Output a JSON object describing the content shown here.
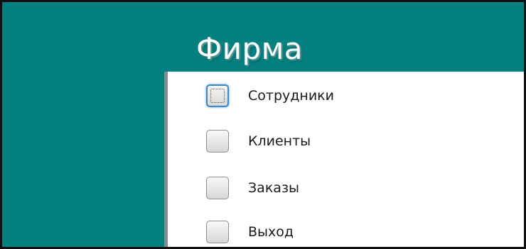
{
  "window": {
    "title": "Фирма",
    "background_color": "#058080"
  },
  "menu": {
    "items": [
      {
        "label": "Сотрудники",
        "checked": false,
        "focused": true
      },
      {
        "label": "Клиенты",
        "checked": false,
        "focused": false
      },
      {
        "label": "Заказы",
        "checked": false,
        "focused": false
      },
      {
        "label": "Выход",
        "checked": false,
        "focused": false
      }
    ]
  }
}
